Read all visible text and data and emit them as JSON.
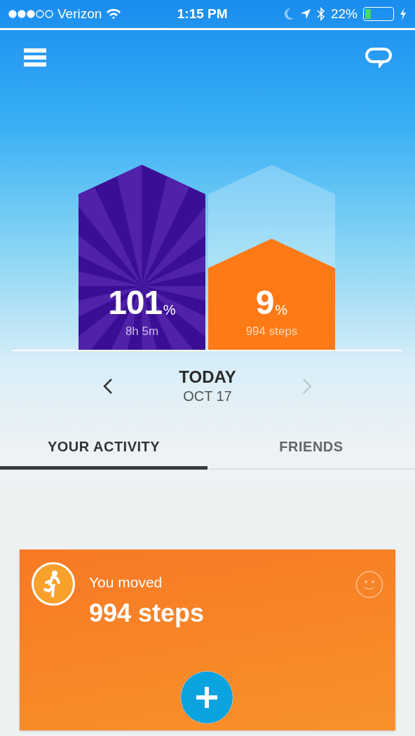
{
  "status_bar": {
    "carrier": "Verizon",
    "time": "1:15 PM",
    "battery": "22%"
  },
  "bars": [
    {
      "kind": "sleep",
      "value": "101",
      "unit": "%",
      "detail": "8h 5m"
    },
    {
      "kind": "steps",
      "value": "9",
      "unit": "%",
      "detail": "994 steps"
    }
  ],
  "date_nav": {
    "title": "TODAY",
    "date": "OCT 17",
    "previous": {
      "disabled": false
    },
    "next": {
      "disabled": true
    }
  },
  "tabs": [
    {
      "label": "YOUR ACTIVITY",
      "selected": true
    },
    {
      "label": "FRIENDS",
      "selected": false
    }
  ],
  "card": {
    "label": "You moved",
    "value": "994 steps"
  }
}
